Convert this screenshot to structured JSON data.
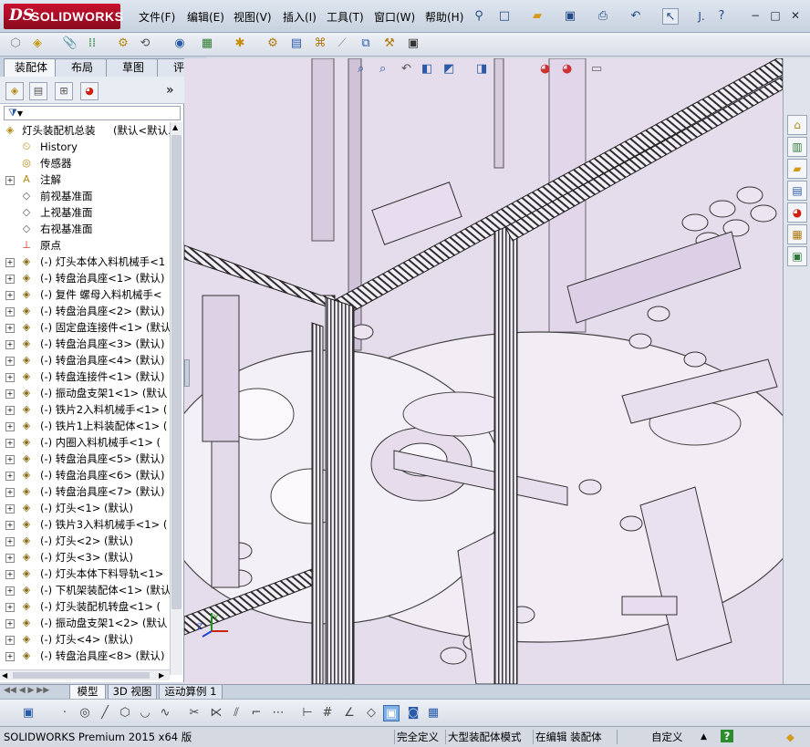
{
  "app": {
    "logo_ds": "DS",
    "logo_name": "SOLIDWORKS"
  },
  "menu": [
    "文件(F)",
    "编辑(E)",
    "视图(V)",
    "插入(I)",
    "工具(T)",
    "窗口(W)",
    "帮助(H)"
  ],
  "title_toolbar": {
    "text_label": "J.",
    "help": "?"
  },
  "tabs": [
    "装配体",
    "布局",
    "草图",
    "评估"
  ],
  "feature_tree": {
    "filter_glyph": "▼",
    "root": {
      "label": "灯头装配机总装",
      "state": "(默认<默认..."
    },
    "items": [
      {
        "icon": "history-icon",
        "label": "History",
        "expandable": false
      },
      {
        "icon": "sensor-icon",
        "label": "传感器",
        "expandable": false
      },
      {
        "icon": "annotation-icon",
        "label": "注解",
        "expandable": true
      },
      {
        "icon": "plane-icon",
        "label": "前视基准面",
        "expandable": false
      },
      {
        "icon": "plane-icon",
        "label": "上视基准面",
        "expandable": false
      },
      {
        "icon": "plane-icon",
        "label": "右视基准面",
        "expandable": false
      },
      {
        "icon": "origin-icon",
        "label": "原点",
        "expandable": false
      },
      {
        "icon": "subassembly-icon",
        "label": "(-) 灯头本体入料机械手<1",
        "expandable": true
      },
      {
        "icon": "subassembly-icon",
        "label": "(-) 转盘治具座<1> (默认)",
        "expandable": true
      },
      {
        "icon": "subassembly-icon",
        "label": "(-) 复件 螺母入料机械手<",
        "expandable": true
      },
      {
        "icon": "subassembly-icon",
        "label": "(-) 转盘治具座<2> (默认)",
        "expandable": true
      },
      {
        "icon": "subassembly-icon",
        "label": "(-) 固定盘连接件<1> (默认",
        "expandable": true
      },
      {
        "icon": "subassembly-icon",
        "label": "(-) 转盘治具座<3> (默认)",
        "expandable": true
      },
      {
        "icon": "subassembly-icon",
        "label": "(-) 转盘治具座<4> (默认)",
        "expandable": true
      },
      {
        "icon": "subassembly-icon",
        "label": "(-) 转盘连接件<1> (默认)",
        "expandable": true
      },
      {
        "icon": "subassembly-icon",
        "label": "(-) 振动盘支架1<1> (默认",
        "expandable": true
      },
      {
        "icon": "subassembly-icon",
        "label": "(-) 铁片2入料机械手<1> (",
        "expandable": true
      },
      {
        "icon": "subassembly-icon",
        "label": "(-) 铁片1上料装配体<1> (",
        "expandable": true
      },
      {
        "icon": "subassembly-icon",
        "label": "(-) 内圈入料机械手<1> (",
        "expandable": true
      },
      {
        "icon": "subassembly-icon",
        "label": "(-) 转盘治具座<5> (默认)",
        "expandable": true
      },
      {
        "icon": "subassembly-icon",
        "label": "(-) 转盘治具座<6> (默认)",
        "expandable": true
      },
      {
        "icon": "subassembly-icon",
        "label": "(-) 转盘治具座<7> (默认)",
        "expandable": true
      },
      {
        "icon": "subassembly-icon",
        "label": "(-) 灯头<1> (默认)",
        "expandable": true
      },
      {
        "icon": "subassembly-icon",
        "label": "(-) 铁片3入料机械手<1> (",
        "expandable": true
      },
      {
        "icon": "subassembly-icon",
        "label": "(-) 灯头<2> (默认)",
        "expandable": true
      },
      {
        "icon": "subassembly-icon",
        "label": "(-) 灯头<3> (默认)",
        "expandable": true
      },
      {
        "icon": "subassembly-icon",
        "label": "(-) 灯头本体下料导轨<1>",
        "expandable": true
      },
      {
        "icon": "subassembly-icon",
        "label": "(-) 下机架装配体<1> (默认",
        "expandable": true
      },
      {
        "icon": "subassembly-icon",
        "label": "(-) 灯头装配机转盘<1> (",
        "expandable": true
      },
      {
        "icon": "subassembly-icon",
        "label": "(-) 振动盘支架1<2> (默认",
        "expandable": true
      },
      {
        "icon": "subassembly-icon",
        "label": "(-) 灯头<4> (默认)",
        "expandable": true
      },
      {
        "icon": "subassembly-icon",
        "label": "(-) 转盘治具座<8> (默认)",
        "expandable": true
      }
    ]
  },
  "bottom_tabs": [
    "模型",
    "3D 视图",
    "运动算例 1"
  ],
  "status": {
    "app_version": "SOLIDWORKS Premium 2015 x64 版",
    "definition": "完全定义",
    "mode": "大型装配体模式",
    "editing": "在编辑 装配体",
    "units": "自定义",
    "units_arrow": "▲",
    "help_mark": "?"
  },
  "colors": {
    "accent": "#c8102e",
    "model_tint": "#e9dcef",
    "frame_dark": "#3a3a3a"
  }
}
